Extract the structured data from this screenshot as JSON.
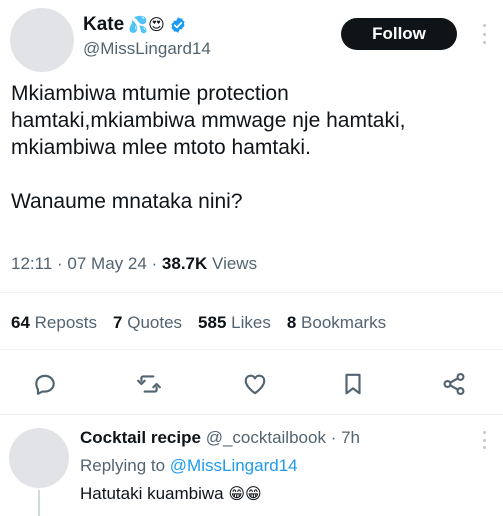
{
  "author": {
    "name": "Kate",
    "emojis": "💦😍",
    "handle": "@MissLingard14",
    "verified": true
  },
  "follow_label": "Follow",
  "tweet": {
    "paragraph1": "Mkiambiwa mtumie protection\nhamtaki,mkiambiwa mmwage nje hamtaki,\nmkiambiwa mlee mtoto hamtaki.",
    "paragraph2": "Wanaume mnataka nini?"
  },
  "meta": {
    "time": "12:11",
    "date": "07 May 24",
    "views_count": "38.7K",
    "views_label": "Views"
  },
  "stats": {
    "reposts_count": "64",
    "reposts_label": "Reposts",
    "quotes_count": "7",
    "quotes_label": "Quotes",
    "likes_count": "585",
    "likes_label": "Likes",
    "bookmarks_count": "8",
    "bookmarks_label": "Bookmarks"
  },
  "actions": [
    "reply-icon",
    "repost-icon",
    "like-icon",
    "bookmark-icon",
    "share-icon"
  ],
  "reply": {
    "name": "Cocktail recipe",
    "handle": "@_cocktailbook",
    "time": "7h",
    "replying_prefix": "Replying to",
    "replying_to": "@MissLingard14",
    "text": "Hatutaki kuambiwa",
    "emojis": "😁😁"
  },
  "colors": {
    "text": "#0f1419",
    "muted": "#536471",
    "link": "#1d9bf0",
    "verified": "#1d9bf0",
    "button_bg": "#0f1419"
  }
}
